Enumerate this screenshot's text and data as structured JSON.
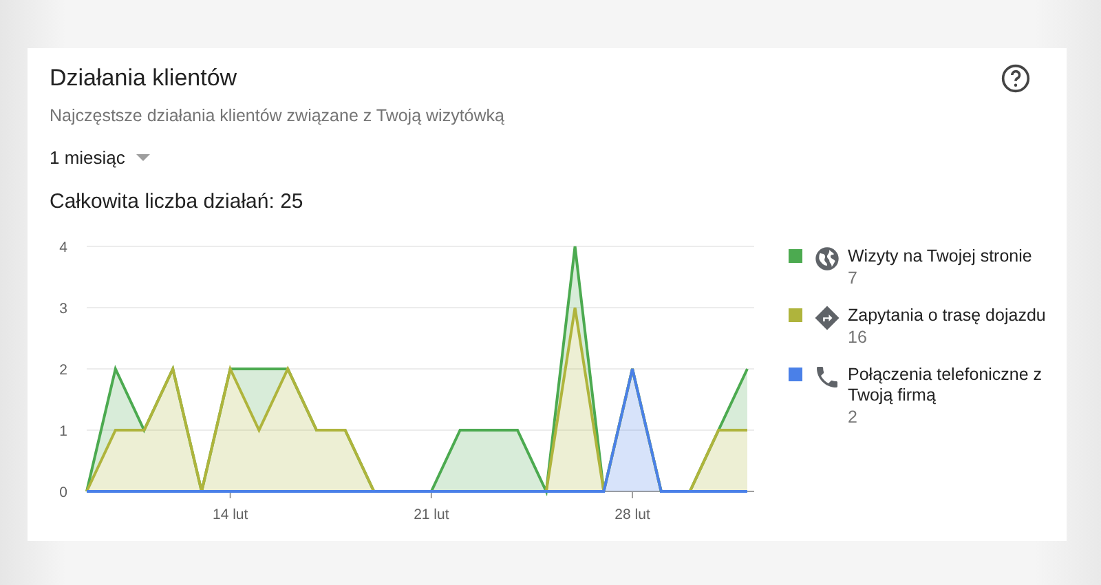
{
  "card": {
    "title": "Działania klientów",
    "subtitle": "Najczęstsze działania klientów związane z Twoją wizytówką",
    "period": "1 miesiąc",
    "total": "Całkowita liczba działań: 25",
    "chart_data": {
      "type": "area",
      "stacked": true,
      "grid": true,
      "categories": [
        null,
        null,
        null,
        null,
        null,
        "14 lut",
        null,
        null,
        null,
        null,
        null,
        null,
        "21 lut",
        null,
        null,
        null,
        null,
        null,
        null,
        "28 lut",
        null,
        null,
        null,
        null
      ],
      "ylim": [
        0,
        4
      ],
      "yticks": [
        0,
        1,
        2,
        3,
        4
      ],
      "series": [
        {
          "name": "Wizyty na Twojej stronie",
          "color": "#4caa50",
          "values": [
            0,
            1,
            0,
            0,
            0,
            0,
            1,
            0,
            0,
            0,
            0,
            0,
            0,
            1,
            1,
            1,
            0,
            1,
            0,
            0,
            0,
            0,
            0,
            1
          ]
        },
        {
          "name": "Zapytania o trasę dojazdu",
          "color": "#afb43c",
          "values": [
            0,
            1,
            1,
            2,
            0,
            2,
            1,
            2,
            1,
            1,
            0,
            0,
            0,
            0,
            0,
            0,
            0,
            3,
            0,
            0,
            0,
            0,
            1,
            1
          ]
        },
        {
          "name": "Połączenia telefoniczne z Twoją firmą",
          "color": "#4a80e8",
          "values": [
            0,
            0,
            0,
            0,
            0,
            0,
            0,
            0,
            0,
            0,
            0,
            0,
            0,
            0,
            0,
            0,
            0,
            0,
            0,
            2,
            0,
            0,
            0,
            0
          ]
        }
      ]
    },
    "legend": [
      {
        "kind": "website",
        "count": "7"
      },
      {
        "kind": "directions",
        "count": "16"
      },
      {
        "kind": "phone",
        "count": "2"
      }
    ]
  }
}
